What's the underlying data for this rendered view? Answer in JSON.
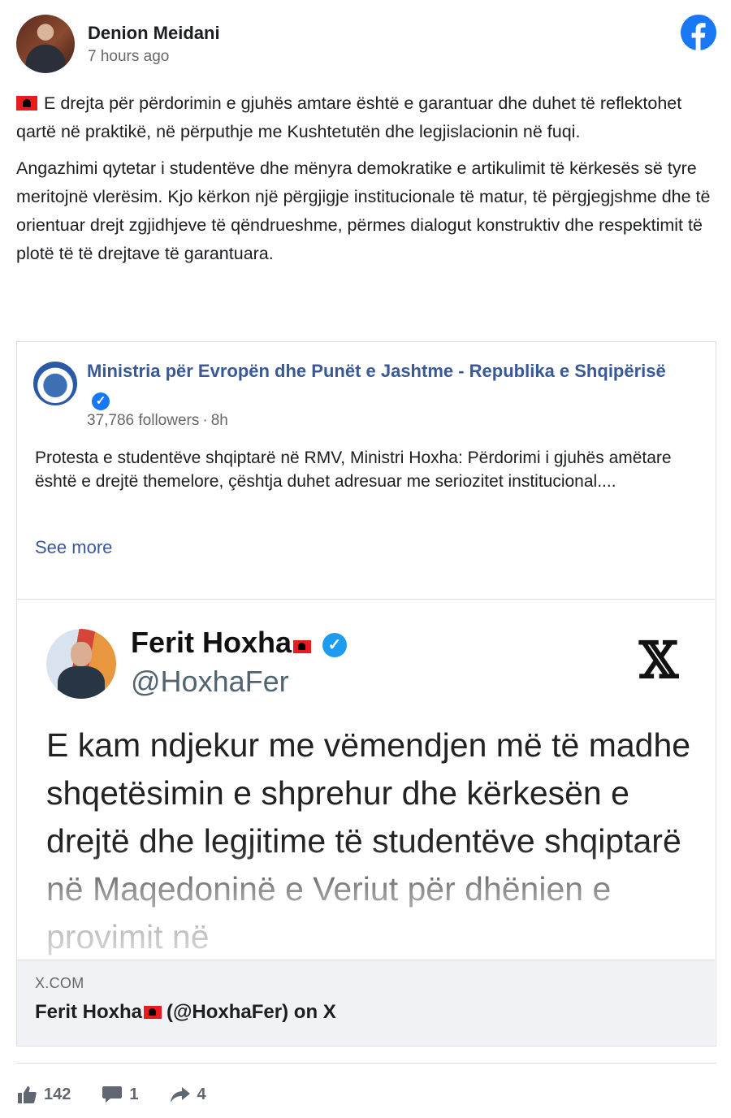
{
  "post": {
    "author": "Denion Meidani",
    "timestamp": "7 hours ago",
    "paragraph1": "E drejta për përdorimin e gjuhës amtare është e garantuar dhe duhet të reflektohet qartë në praktikë, në përputhje me Kushtetutën dhe legjislacionin në fuqi.",
    "paragraph2": "Angazhimi qytetar i studentëve dhe mënyra demokratike e artikulimit të kërkesës së tyre meritojnë vlerësim. Kjo kërkon një përgjigje institucionale të matur, të përgjegjshme dhe të orientuar drejt zgjidhjeve të qëndrueshme, përmes dialogut konstruktiv dhe respektimit të plotë të të drejtave të garantuara."
  },
  "shared": {
    "page_name": "Ministria për Evropën dhe Punët e Jashtme - Republika e Shqipërisë",
    "followers": "37,786 followers",
    "age": "8h",
    "text": "Protesta e studentëve shqiptarë në RMV, Ministri Hoxha: Përdorimi i gjuhës amëtare është e drejtë themelore, çështja duhet adresuar me seriozitet institucional....",
    "see_more": "See more"
  },
  "tweet": {
    "name": "Ferit Hoxha",
    "handle": "@HoxhaFer",
    "text": "E kam ndjekur me vëmendjen më të madhe shqetësimin e shprehur dhe kërkesën e drejtë dhe legjitime të studentëve shqiptarë në Maqedoninë e Veriut për dhënien e provimit në"
  },
  "link": {
    "domain": "X.COM",
    "title_name": "Ferit Hoxha",
    "title_rest": "(@HoxhaFer) on X"
  },
  "stats": {
    "likes": "142",
    "comments": "1",
    "shares": "4"
  },
  "colors": {
    "facebook_blue": "#1877f2",
    "link_blue": "#385898",
    "secondary_text": "#65676b",
    "albanian_red": "#e41e20"
  },
  "icons": [
    "facebook-logo-icon",
    "albania-flag-icon",
    "verified-badge-icon",
    "x-logo-icon",
    "like-icon",
    "comment-icon",
    "share-icon"
  ]
}
